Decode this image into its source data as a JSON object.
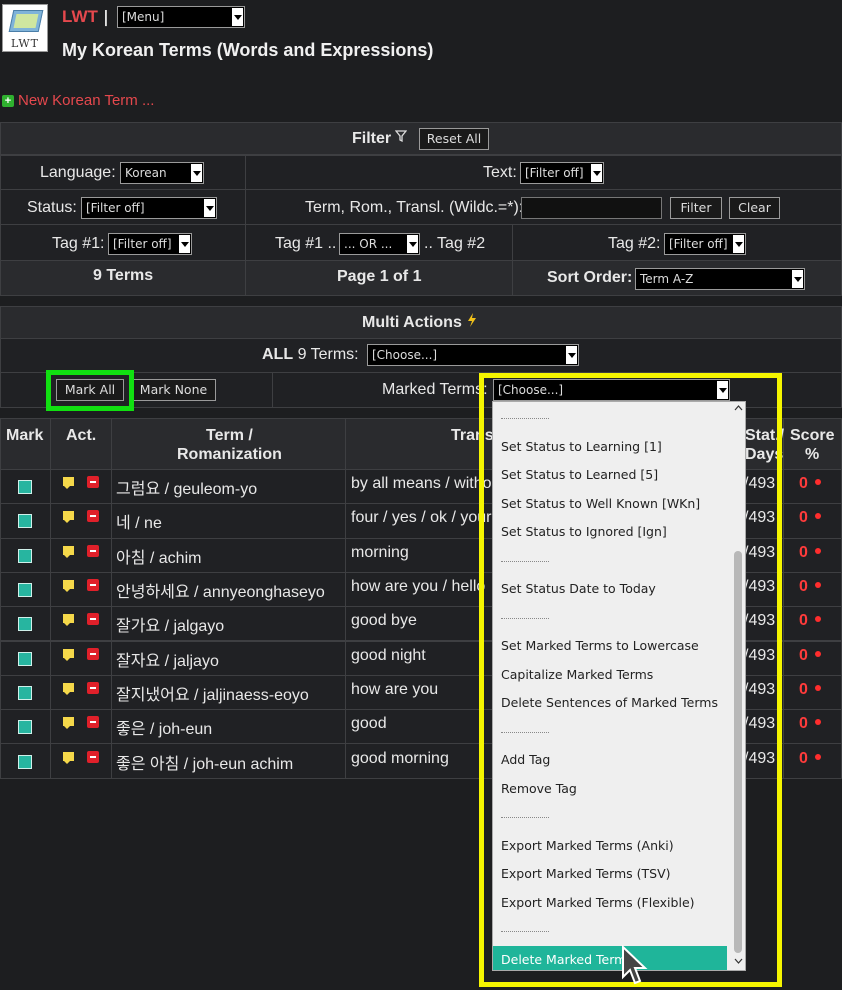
{
  "header": {
    "logo_text": "LWT",
    "app_name": "LWT",
    "separator": "|",
    "menu_select": "[Menu]",
    "page_title": "My Korean Terms (Words and Expressions)"
  },
  "new_term_link": "New Korean Term ...",
  "filter": {
    "title": "Filter",
    "reset_all": "Reset All",
    "language_label": "Language:",
    "language_value": "Korean",
    "text_label": "Text:",
    "text_value": "[Filter off]",
    "status_label": "Status:",
    "status_value": "[Filter off]",
    "search_label": "Term, Rom., Transl. (Wildc.=*):",
    "search_value": "",
    "filter_button": "Filter",
    "clear_button": "Clear",
    "tag1_label": "Tag #1:",
    "tag1_value": "[Filter off]",
    "tag_combine_prefix": "Tag #1 ..",
    "tag_combine_value": "... OR ...",
    "tag_combine_suffix": ".. Tag #2",
    "tag2_label": "Tag #2:",
    "tag2_value": "[Filter off]",
    "terms_count": "9 Terms",
    "page_info": "Page 1 of 1",
    "sort_label": "Sort Order:",
    "sort_value": "Term A-Z"
  },
  "multi_actions": {
    "title": "Multi Actions",
    "all_prefix": "ALL",
    "all_count": "9 Terms:",
    "all_select": "[Choose...]",
    "mark_all": "Mark All",
    "mark_none": "Mark None",
    "marked_label": "Marked Terms:",
    "marked_select": "[Choose...]"
  },
  "table": {
    "headers": {
      "mark": "Mark",
      "act": "Act.",
      "term": "Term /",
      "term2": "Romanization",
      "translation": "Trans",
      "status": "Stat./",
      "status2": "Days",
      "score": "Score",
      "score2": "%"
    },
    "rows": [
      {
        "term": "그럼요 / geuleom-yo",
        "translation": "by all means / without",
        "status": "/493",
        "score": "0"
      },
      {
        "term": "네 / ne",
        "translation": "four / yes / ok / your",
        "status": "/493",
        "score": "0"
      },
      {
        "term": "아침 / achim",
        "translation": "morning",
        "status": "/493",
        "score": "0"
      },
      {
        "term": "안녕하세요 / annyeonghaseyo",
        "translation": "how are you / hello",
        "status": "/493",
        "score": "0"
      },
      {
        "term": "잘가요 / jalgayo",
        "translation": "good bye",
        "status": "/493",
        "score": "0"
      },
      {
        "term": "잘자요 / jaljayo",
        "translation": "good night",
        "status": "/493",
        "score": "0"
      },
      {
        "term": "잘지냈어요 / jaljinaess-eoyo",
        "translation": "how are you",
        "status": "/493",
        "score": "0"
      },
      {
        "term": "좋은 / joh-eun",
        "translation": "good",
        "status": "/493",
        "score": "0"
      },
      {
        "term": "좋은 아침 / joh-eun achim",
        "translation": "good morning",
        "status": "/493",
        "score": "0"
      }
    ]
  },
  "dropdown": {
    "options": [
      {
        "type": "sep"
      },
      {
        "type": "opt",
        "label": "Set Status to Learning [1]"
      },
      {
        "type": "opt",
        "label": "Set Status to Learned [5]"
      },
      {
        "type": "opt",
        "label": "Set Status to Well Known [WKn]"
      },
      {
        "type": "opt",
        "label": "Set Status to Ignored [Ign]"
      },
      {
        "type": "sep"
      },
      {
        "type": "opt",
        "label": "Set Status Date to Today"
      },
      {
        "type": "sep"
      },
      {
        "type": "opt",
        "label": "Set Marked Terms to Lowercase"
      },
      {
        "type": "opt",
        "label": "Capitalize Marked Terms"
      },
      {
        "type": "opt",
        "label": "Delete Sentences of Marked Terms"
      },
      {
        "type": "sep"
      },
      {
        "type": "opt",
        "label": "Add Tag"
      },
      {
        "type": "opt",
        "label": "Remove Tag"
      },
      {
        "type": "sep"
      },
      {
        "type": "opt",
        "label": "Export Marked Terms (Anki)"
      },
      {
        "type": "opt",
        "label": "Export Marked Terms (TSV)"
      },
      {
        "type": "opt",
        "label": "Export Marked Terms (Flexible)"
      },
      {
        "type": "sep"
      },
      {
        "type": "opt",
        "label": "Delete Marked Terms",
        "selected": true
      }
    ]
  },
  "colors": {
    "accent_red": "#e5484d",
    "highlight_green": "#11e011",
    "highlight_yellow": "#f5f500",
    "selected_option": "#1fb59a"
  }
}
